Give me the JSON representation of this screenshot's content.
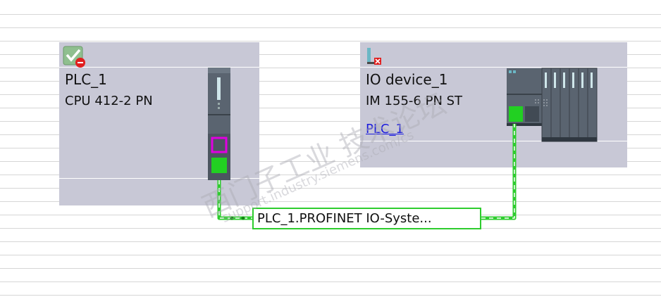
{
  "plc": {
    "name": "PLC_1",
    "type": "CPU 412-2 PN",
    "status_icon": "checkmark-with-error-icon"
  },
  "io_device": {
    "name": "IO device_1",
    "type": "IM 155-6 PN ST",
    "assigned_controller": "PLC_1",
    "status_icon": "device-not-assigned-icon"
  },
  "network": {
    "label": "PLC_1.PROFINET IO-Syste..."
  },
  "colors": {
    "device_bg": "#c8c8d6",
    "profinet_line": "#2ecc2e",
    "port_highlight": "#e000e0",
    "link": "#1a1adc"
  },
  "watermark": {
    "line1": "西门子工业  技术论坛",
    "line2": "support.industry.siemens.com/cs"
  }
}
